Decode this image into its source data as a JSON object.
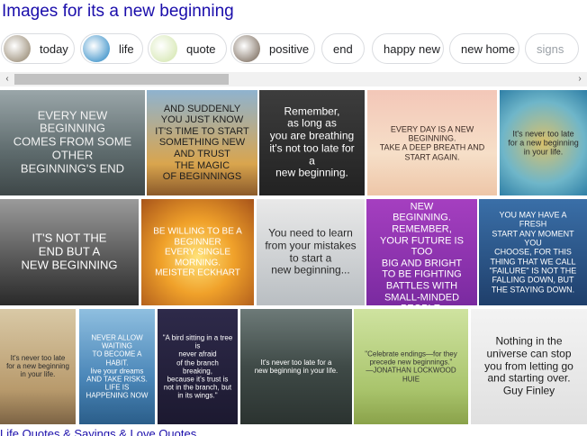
{
  "title": "Images for its a new beginning",
  "chips": [
    {
      "label": "today",
      "has_thumb": true,
      "thumb_color": "#8a7b62"
    },
    {
      "label": "life",
      "has_thumb": true,
      "thumb_color": "#1b7fc0"
    },
    {
      "label": "quote",
      "has_thumb": true,
      "thumb_color": "#cfe3a6"
    },
    {
      "label": "positive",
      "has_thumb": true,
      "thumb_color": "#6b5a4a"
    },
    {
      "label": "end",
      "has_thumb": false
    },
    {
      "label": "happy new",
      "has_thumb": false
    },
    {
      "label": "new home",
      "has_thumb": false
    },
    {
      "label": "signs",
      "has_thumb": false
    }
  ],
  "scroll": {
    "left_arrow": "‹",
    "right_arrow": "›"
  },
  "images": [
    {
      "text": "EVERY NEW BEGINNING\nCOMES FROM SOME OTHER\nBEGINNING'S END",
      "bg": "linear-gradient(180deg,#9aa6a9,#5d6a6c 60%,#3e4748)",
      "color": "#f2f2f2"
    },
    {
      "text": "AND SUDDENLY\nYOU JUST KNOW\nIT'S TIME TO START\nSOMETHING NEW\nAND TRUST\nTHE MAGIC\nOF BEGINNINGS",
      "bg": "linear-gradient(180deg,#8fb3cf,#d9a54e 70%,#8b5a2a)",
      "color": "#1e1e1e"
    },
    {
      "text": "Remember,\nas long as\nyou are breathing\nit's not too late for a\nnew beginning.",
      "bg": "linear-gradient(180deg,#3d3d3d,#222)",
      "color": "#ffffff"
    },
    {
      "text": "EVERY DAY IS A NEW BEGINNING.\nTAKE A DEEP BREATH AND\nSTART AGAIN.",
      "bg": "linear-gradient(180deg,#f3c7b8,#f6dfc8 60%,#eec6a8)",
      "color": "#3b2a24"
    },
    {
      "text": "It's never too late\nfor a new beginning\nin your life.",
      "bg": "radial-gradient(circle at 50% 50%,#d9c06a,#6fb6c9 60%,#2f7fa6)",
      "color": "#2a2a2a"
    },
    {
      "text": "IT'S NOT THE\nEND BUT A\nNEW BEGINNING",
      "bg": "linear-gradient(180deg,#9b9b9b,#5a5a5a 55%,#2a2a2a)",
      "color": "#ffffff"
    },
    {
      "text": "BE WILLING TO BE A BEGINNER\nEVERY SINGLE MORNING.\nMEISTER ECKHART",
      "bg": "radial-gradient(circle at 50% 55%,#ffe37a,#f0a12a 45%,#a8541a)",
      "color": "#ffffff"
    },
    {
      "text": "You need to learn\nfrom your mistakes\nto start a\nnew beginning...",
      "bg": "linear-gradient(180deg,#e9e9e9,#b9bec2)",
      "color": "#2a2a2a"
    },
    {
      "text": "IT'S A NEW DAY, A NEW\nBEGINNING. REMEMBER,\nYOUR FUTURE IS TOO\nBIG AND BRIGHT\nTO BE FIGHTING\nBATTLES WITH\nSMALL-MINDED PEOPLE.",
      "bg": "linear-gradient(180deg,#a53fc0,#7a2aa0)",
      "color": "#ffffff"
    },
    {
      "text": "YOU MAY HAVE A FRESH\nSTART ANY MOMENT YOU\nCHOOSE, FOR THIS\nTHING THAT WE CALL\n\"FAILURE\" IS NOT THE\nFALLING DOWN, BUT\nTHE STAYING DOWN.",
      "bg": "linear-gradient(180deg,#3a6fa8,#1f3f6b)",
      "color": "#ffffff"
    },
    {
      "text": "It's never too late\nfor a new beginning\nin your life.",
      "bg": "linear-gradient(180deg,#d9c9a6,#b89a6c 70%,#7c6344)",
      "color": "#2a2a2a"
    },
    {
      "text": "NEVER ALLOW WAITING\nTO BECOME A HABIT.\nlive your dreams\nAND TAKE RISKS.\nLIFE IS HAPPENING NOW",
      "bg": "linear-gradient(180deg,#8fbfe0,#4a86b8 60%,#2b5e8a)",
      "color": "#ffffff"
    },
    {
      "text": "\"A bird sitting in a tree is\nnever afraid\nof the branch breaking,\nbecause it's trust is\nnot in the branch, but\nin its wings.\"",
      "bg": "linear-gradient(180deg,#2e2a4a,#1c1930)",
      "color": "#ffffff"
    },
    {
      "text": "It's never too late for a\nnew beginning in your life.",
      "bg": "linear-gradient(180deg,#6d7a78,#3f4a47 50%,#2b3330)",
      "color": "#ffffff"
    },
    {
      "text": "\"Celebrate endings—for they\nprecede new beginnings.\"\n—JONATHAN LOCKWOOD HUIE",
      "bg": "linear-gradient(180deg,#cfe3a0,#a9c46c 70%,#8aa24a)",
      "color": "#333333"
    },
    {
      "text": "Nothing in the\nuniverse can stop\nyou from letting go\nand starting over.\nGuy Finley",
      "bg": "linear-gradient(180deg,#f3f3f3,#e0e0e0)",
      "color": "#202020"
    }
  ],
  "bottom_text": "Life Quotes & Sayings & Love Quotes"
}
